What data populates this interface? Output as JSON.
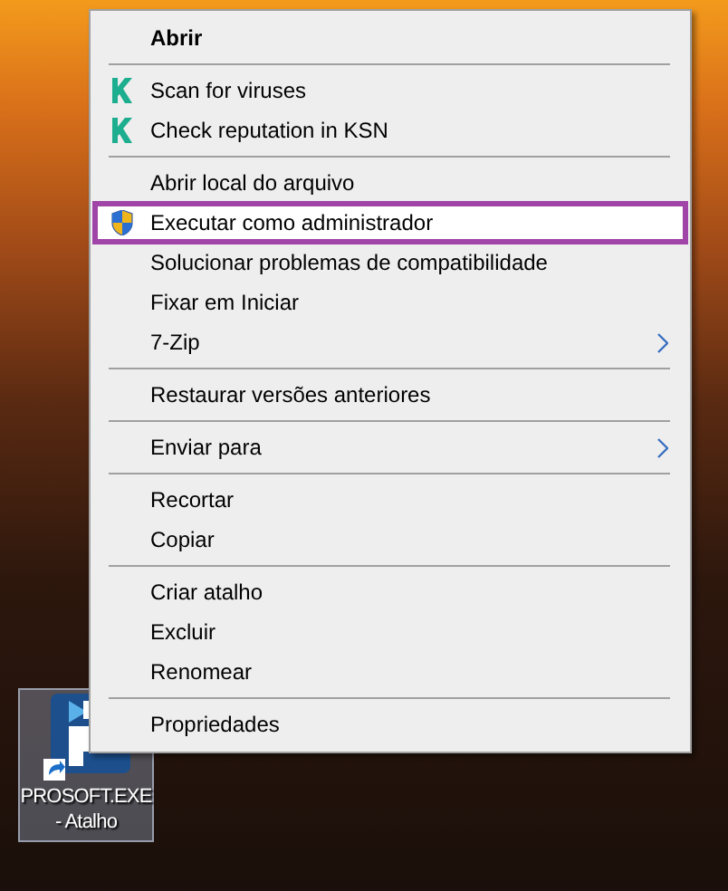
{
  "menu": {
    "items": [
      {
        "kind": "item",
        "label": "Abrir",
        "default": true
      },
      {
        "kind": "separator"
      },
      {
        "kind": "k-item",
        "label": "Scan for viruses"
      },
      {
        "kind": "k-item",
        "label": "Check reputation in KSN"
      },
      {
        "kind": "separator"
      },
      {
        "kind": "item",
        "label": "Abrir local do arquivo"
      },
      {
        "kind": "shield-item",
        "label": "Executar como administrador",
        "highlighted": true
      },
      {
        "kind": "item",
        "label": "Solucionar problemas de compatibilidade"
      },
      {
        "kind": "item",
        "label": "Fixar em Iniciar"
      },
      {
        "kind": "item",
        "label": "7-Zip",
        "submenu": true
      },
      {
        "kind": "separator"
      },
      {
        "kind": "item",
        "label": "Restaurar versões anteriores"
      },
      {
        "kind": "separator"
      },
      {
        "kind": "item",
        "label": "Enviar para",
        "submenu": true
      },
      {
        "kind": "separator"
      },
      {
        "kind": "item",
        "label": "Recortar"
      },
      {
        "kind": "item",
        "label": "Copiar"
      },
      {
        "kind": "separator"
      },
      {
        "kind": "item",
        "label": "Criar atalho"
      },
      {
        "kind": "item",
        "label": "Excluir"
      },
      {
        "kind": "item",
        "label": "Renomear"
      },
      {
        "kind": "separator"
      },
      {
        "kind": "item",
        "label": "Propriedades"
      }
    ]
  },
  "desktop_icon": {
    "label": "PROSOFT.EXE - Atalho",
    "selected": true
  }
}
